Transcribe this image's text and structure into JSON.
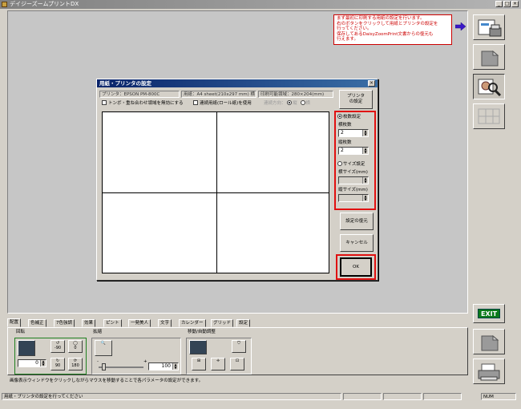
{
  "app": {
    "title": "デイジーズームプリントDX"
  },
  "help": {
    "lines": [
      "まず最初に印刷する用紙の設定を行います。",
      "右のボタンをクリックして用紙とプリンタの設定を",
      "行ってください。",
      "保存してあるDaisyZoomPrint文書からの復元も",
      "行えます。"
    ]
  },
  "dialog": {
    "title": "用紙・プリンタの設定",
    "printer": "プリンタ：EPSON PM-800C",
    "paper": "用紙：A4 sheet(210x297 mm) 横",
    "printable": "印刷可能領域：280×204(mm)",
    "check_trim": "トンボ・重ね合わせ領域を無効にする",
    "check_roll": "連続用紙(ロール紙)を使用",
    "roll_dir_label": "連続方向：",
    "roll_dir_options": [
      "縦",
      "横"
    ],
    "printer_btn": [
      "プリンタ",
      "の設定"
    ],
    "count_mode": "枚数設定",
    "h_count_label": "横枚数",
    "h_count": "2",
    "v_count_label": "縦枚数",
    "v_count": "2",
    "size_mode": "サイズ設定",
    "h_size_label": "横サイズ(mm)",
    "h_size": "",
    "v_size_label": "縦サイズ(mm)",
    "v_size": "",
    "restore_btn": "設定の復元",
    "cancel_btn": "キャンセル",
    "ok_btn": "OK"
  },
  "tabs": [
    {
      "label": "配置",
      "active": true
    },
    {
      "label": "色補正"
    },
    {
      "label": "7色強調"
    },
    {
      "label": "効果"
    },
    {
      "label": "ピント"
    },
    {
      "label": "一発美人"
    },
    {
      "label": "文字"
    },
    {
      "label": "カレンダー"
    },
    {
      "label": "グリッド"
    },
    {
      "label": "設定"
    }
  ],
  "panel": {
    "rotate_label": "回転",
    "rot_minus90": "-90",
    "rot_zero": "0",
    "rot_plus90": "90",
    "rot_180": "180",
    "rot_value": "0",
    "zoom_label": "拡縮",
    "zoom_minus": "-",
    "zoom_plus": "+",
    "zoom_value": "100",
    "move_label": "移動/自動調整"
  },
  "status": {
    "description": "画像表示ウィンドウをクリックしながらマウスを移動することで各パラメータの設定ができます。",
    "message": "用紙・プリンタの設定を行ってください",
    "num": "NUM"
  },
  "colors": {
    "highlight": "#e01010",
    "exit": "#0a7a1a",
    "title": "#0a246a"
  }
}
